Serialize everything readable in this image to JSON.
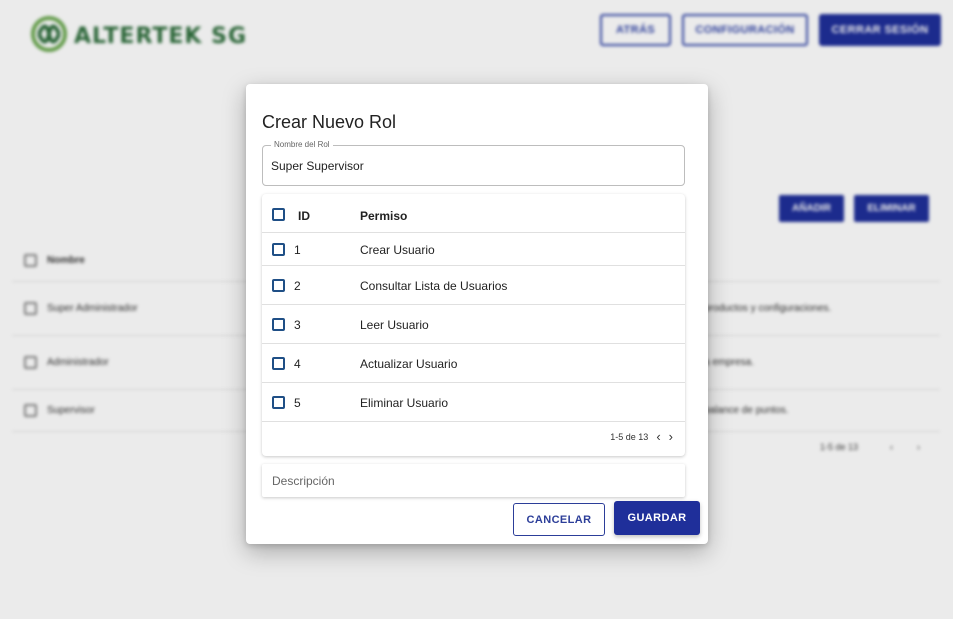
{
  "header": {
    "logo_text": "ALTERTEK SG",
    "back_label": "ATRÁS",
    "config_label": "CONFIGURACIÓN",
    "logout_label": "CERRAR SESIÓN"
  },
  "roles_page": {
    "add_label": "AÑADIR",
    "delete_label": "ELIMINAR",
    "column_name": "Nombre",
    "rows": [
      {
        "name": "Super Administrador",
        "description": "productos y configuraciones."
      },
      {
        "name": "Administrador",
        "description": "a empresa."
      },
      {
        "name": "Supervisor",
        "description": "balance de puntos."
      }
    ],
    "pagination": "1-5 de 13"
  },
  "dialog": {
    "title": "Crear Nuevo Rol",
    "role_name_label": "Nombre del Rol",
    "role_name_value": "Super Supervisor",
    "columns": {
      "id": "ID",
      "permission": "Permiso"
    },
    "permissions": [
      {
        "id": "1",
        "name": "Crear Usuario"
      },
      {
        "id": "2",
        "name": "Consultar Lista de Usuarios"
      },
      {
        "id": "3",
        "name": "Leer Usuario"
      },
      {
        "id": "4",
        "name": "Actualizar Usuario"
      },
      {
        "id": "5",
        "name": "Eliminar Usuario"
      }
    ],
    "pagination": "1-5 de 13",
    "prev_icon": "chevron-left-icon",
    "next_icon": "chevron-right-icon",
    "description_placeholder": "Descripción",
    "cancel_label": "CANCELAR",
    "save_label": "GUARDAR"
  },
  "colors": {
    "primary": "#1f2f9a",
    "logo_green": "#2f6f3d",
    "checkbox_blue": "#1f4f86"
  }
}
